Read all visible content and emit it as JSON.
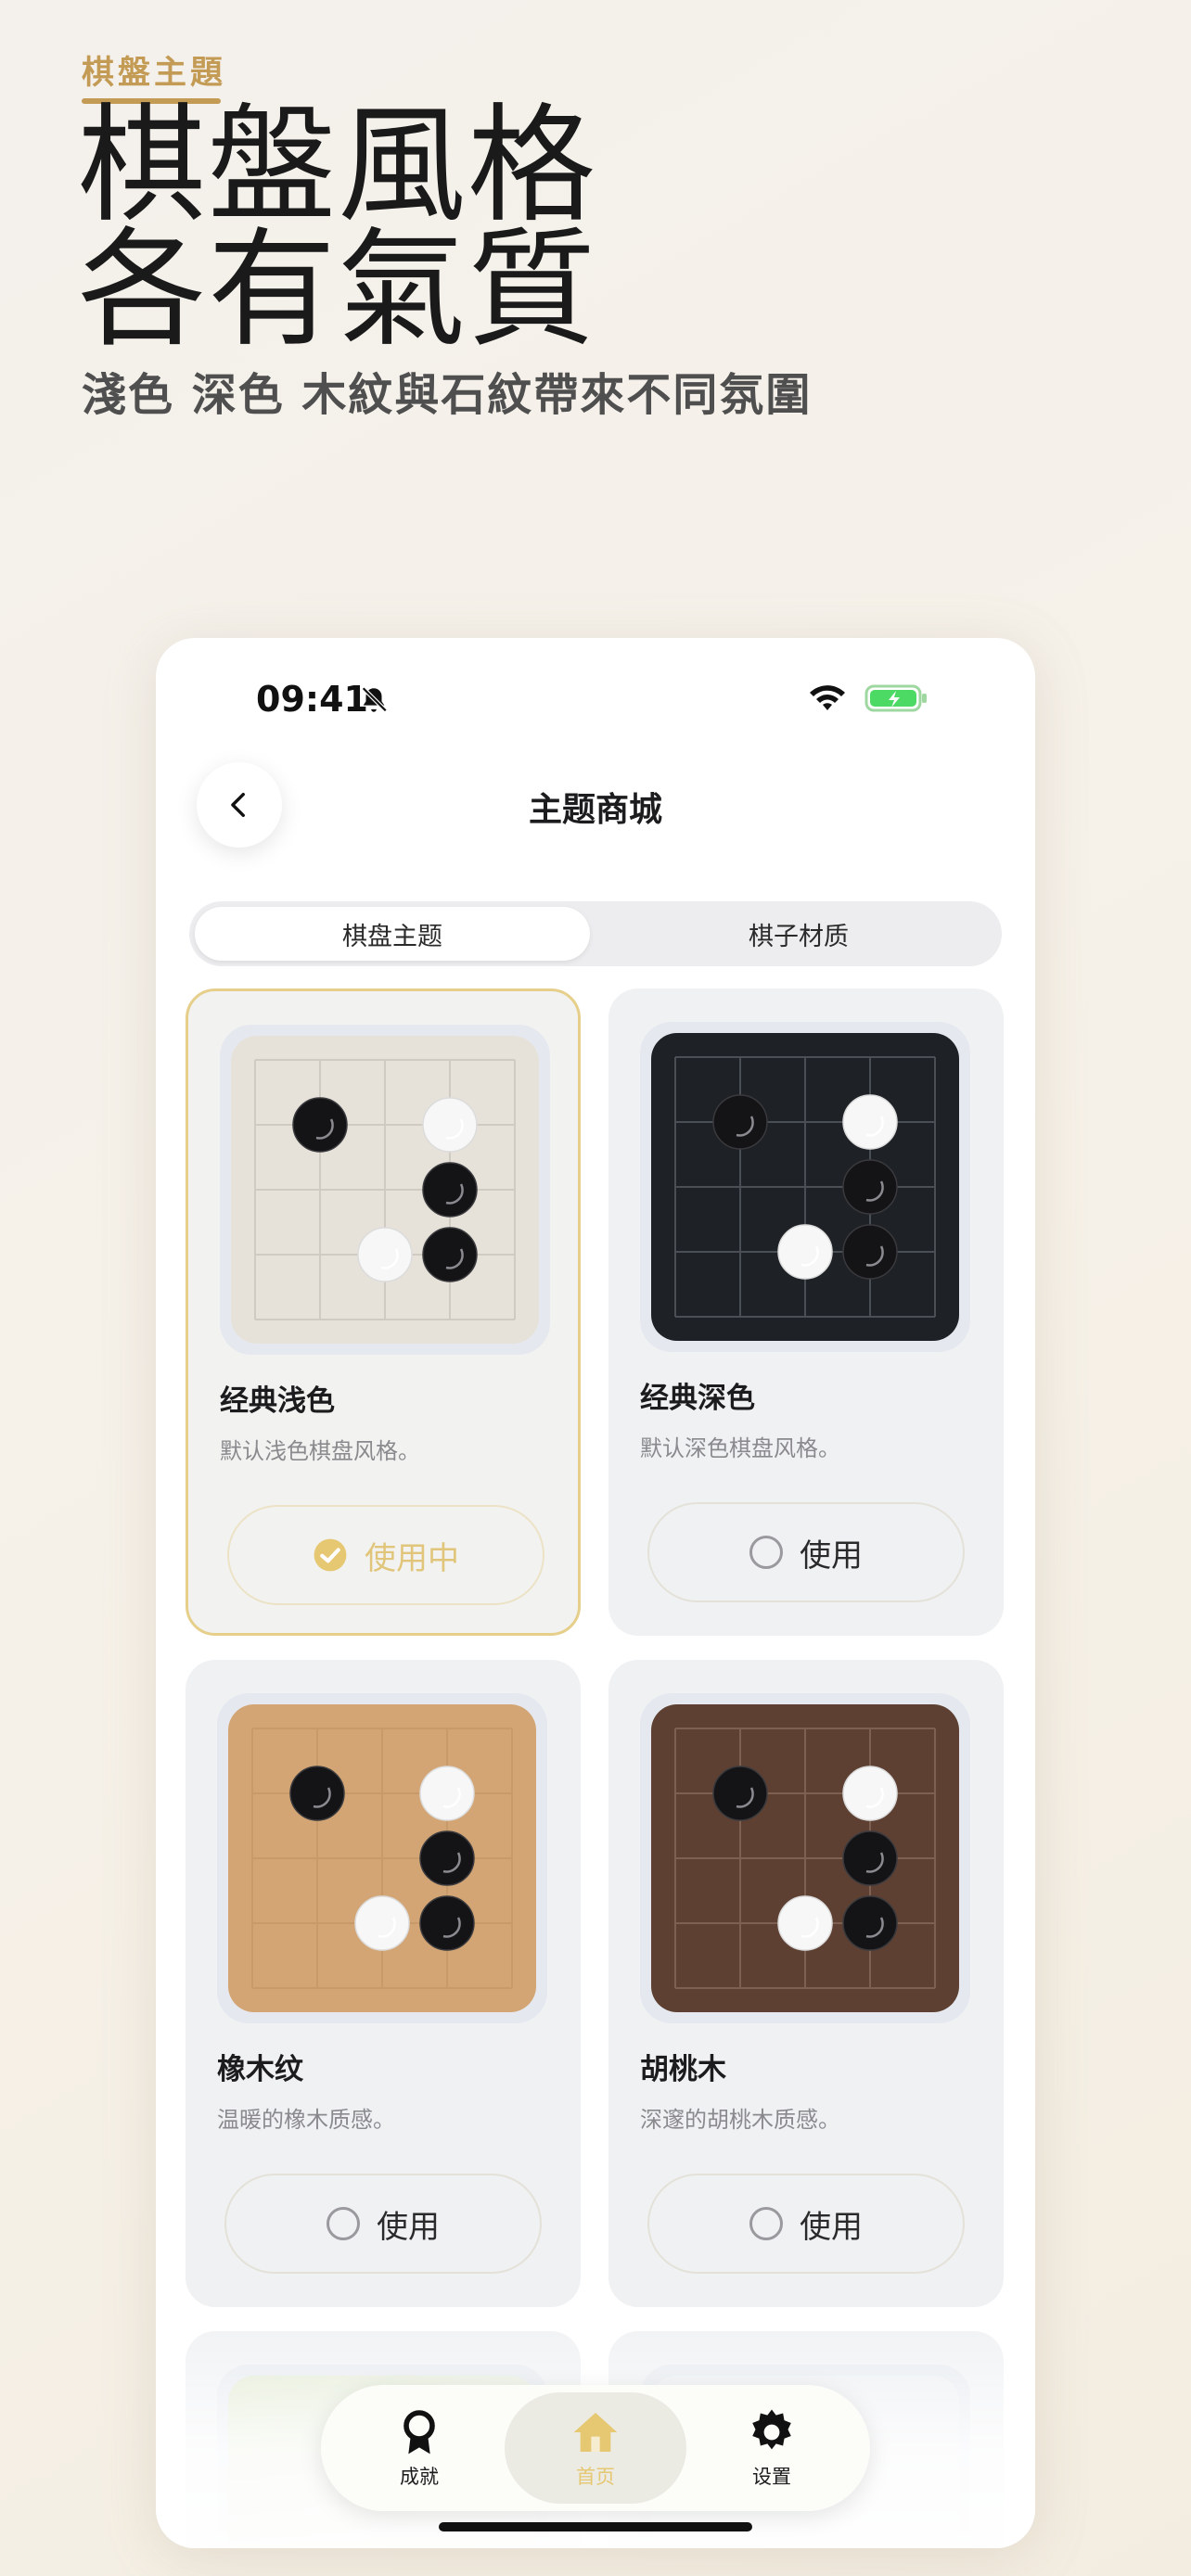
{
  "promo": {
    "tag": "棋盤主題",
    "title_line1": "棋盤風格",
    "title_line2": "各有氣質",
    "subtitle": "淺色 深色 木紋與石紋帶來不同氛圍"
  },
  "status_bar": {
    "time": "09:41"
  },
  "header": {
    "title": "主题商城",
    "back_icon": "chevron-left-icon"
  },
  "segments": [
    {
      "label": "棋盘主题",
      "active": true
    },
    {
      "label": "棋子材质",
      "active": false
    }
  ],
  "themes": [
    {
      "name": "经典浅色",
      "desc": "默认浅色棋盘风格。",
      "button": "使用中",
      "in_use": true,
      "board_color": "#e6e2da",
      "line_color": "#cfcbc2"
    },
    {
      "name": "经典深色",
      "desc": "默认深色棋盘风格。",
      "button": "使用",
      "in_use": false,
      "board_color": "#1e2126",
      "line_color": "#4a4e55"
    },
    {
      "name": "橡木纹",
      "desc": "温暖的橡木质感。",
      "button": "使用",
      "in_use": false,
      "board_color": "#d3a574",
      "line_color": "#c99a69"
    },
    {
      "name": "胡桃木",
      "desc": "深邃的胡桃木质感。",
      "button": "使用",
      "in_use": false,
      "board_color": "#5e4033",
      "line_color": "#7d6052"
    }
  ],
  "tabbar": [
    {
      "label": "成就",
      "icon": "award-icon",
      "active": false
    },
    {
      "label": "首页",
      "icon": "home-icon",
      "active": true
    },
    {
      "label": "设置",
      "icon": "gear-icon",
      "active": false
    }
  ],
  "colors": {
    "accent_gold": "#c39b55",
    "selected_border": "#e6cf8b"
  }
}
